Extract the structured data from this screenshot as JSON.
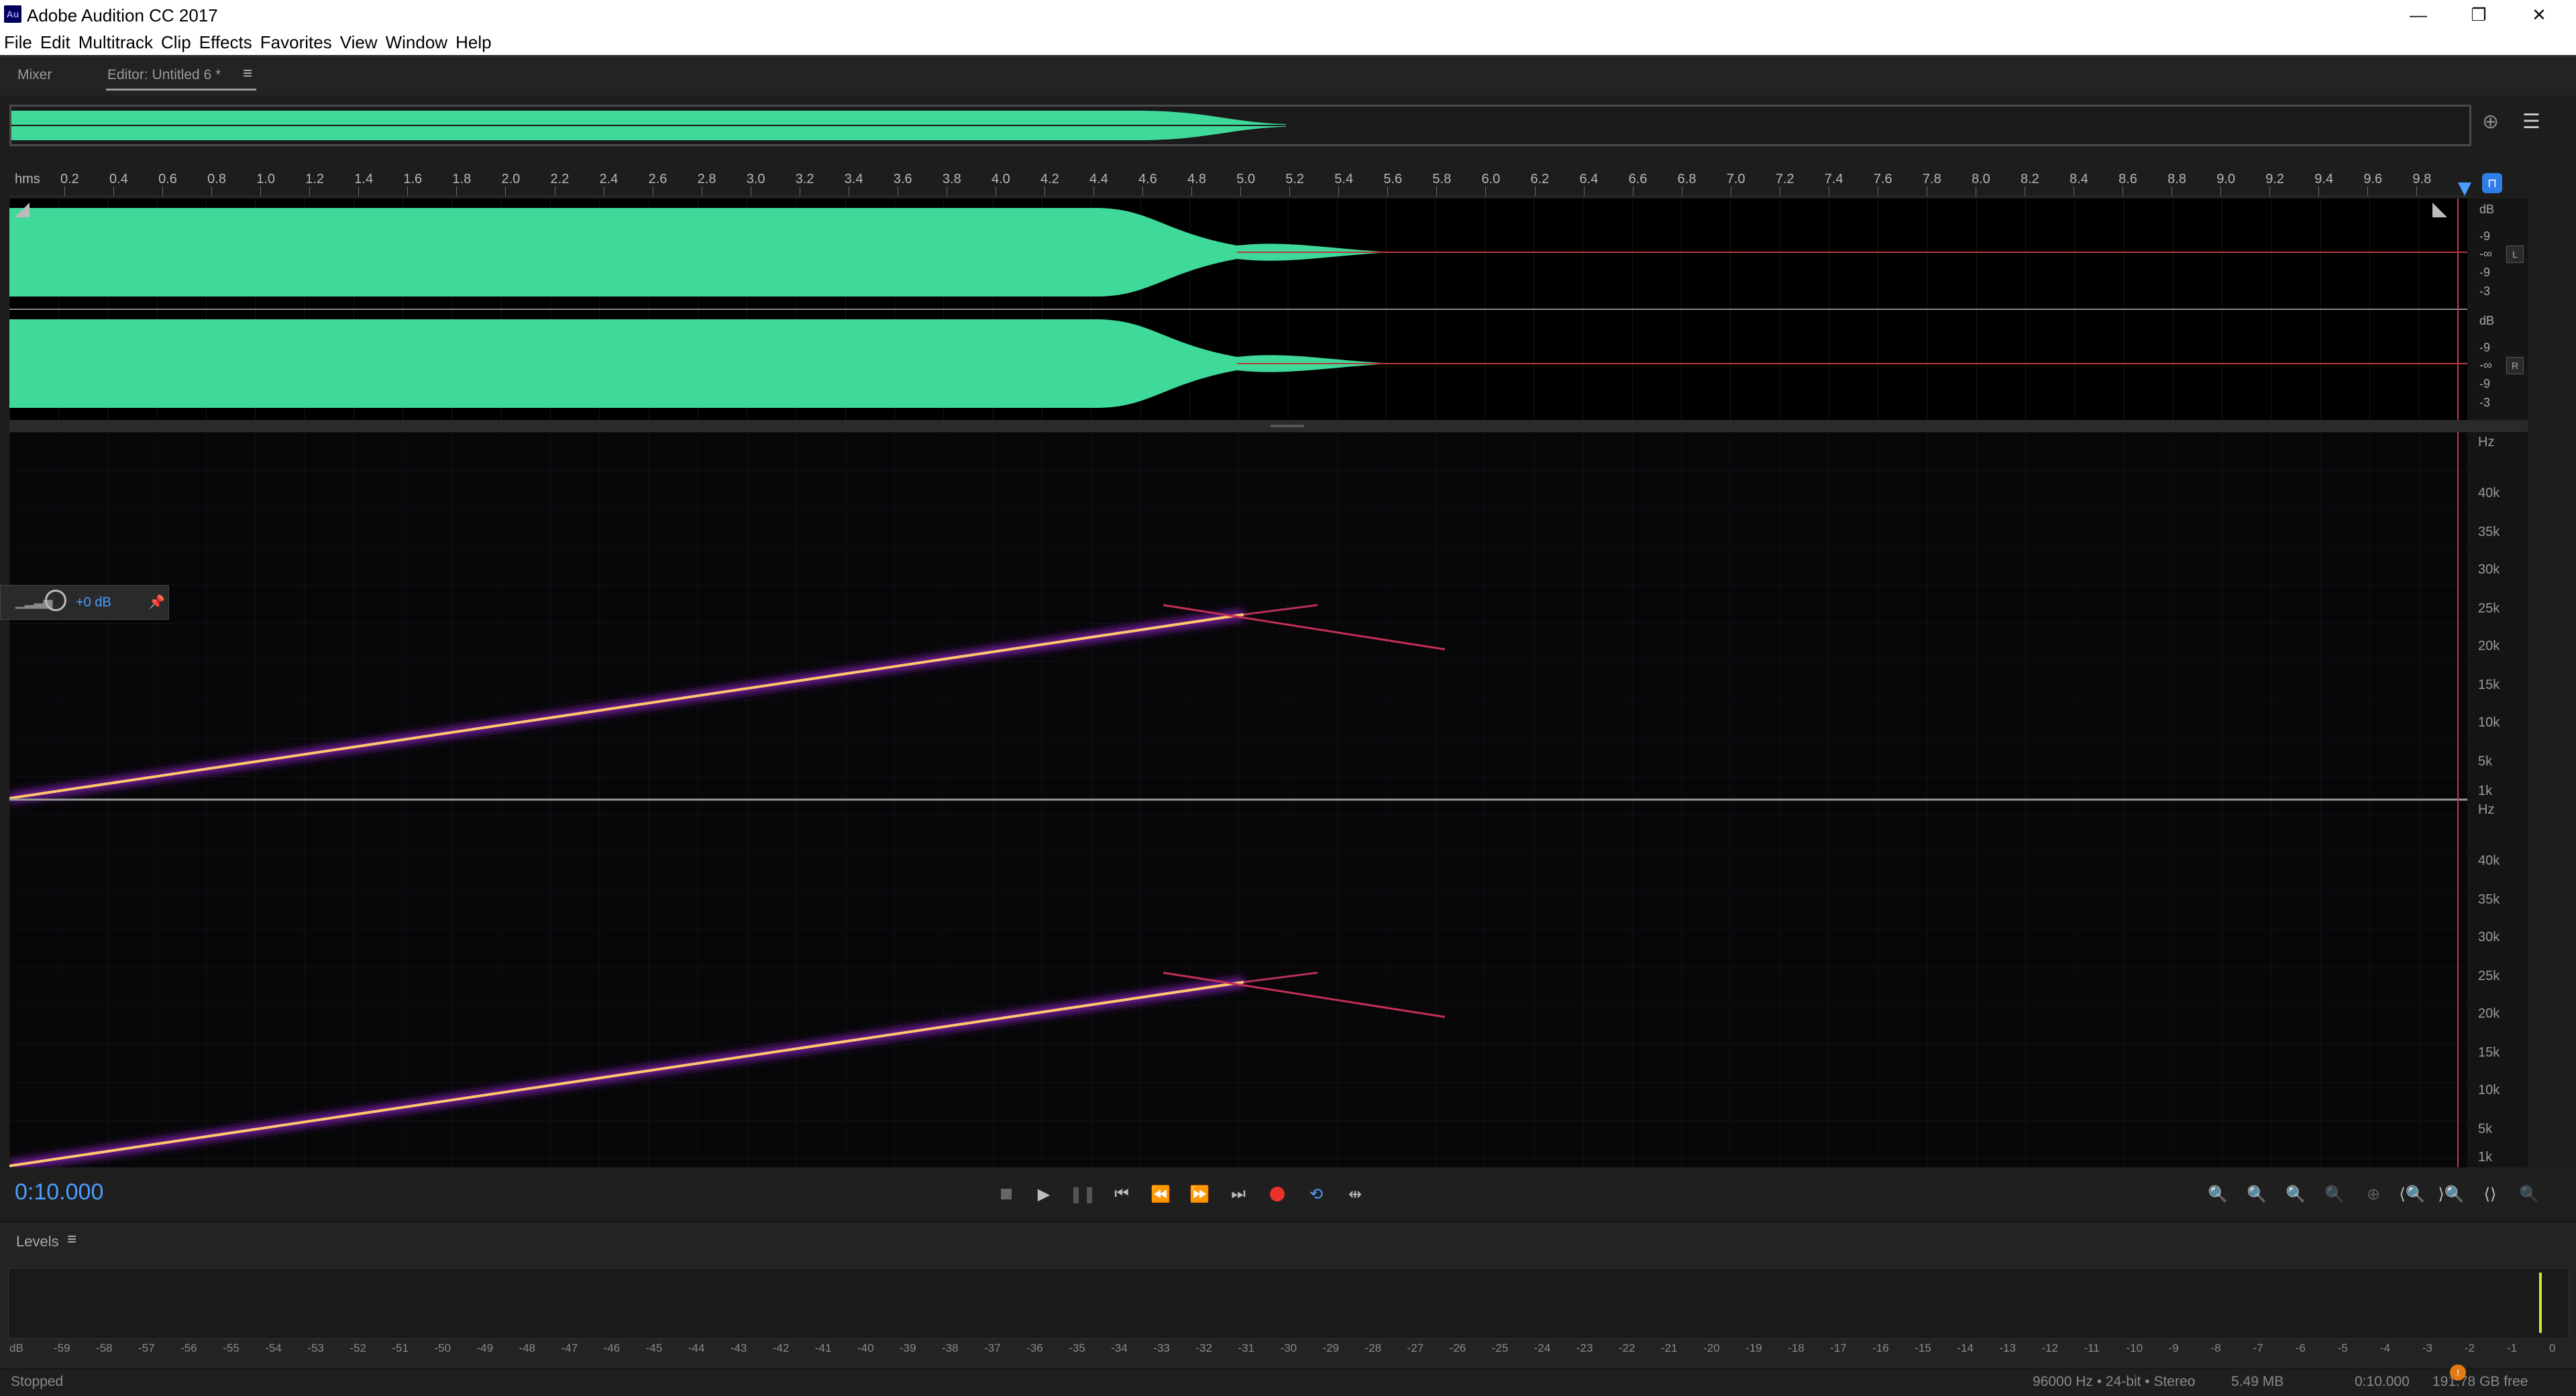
{
  "window": {
    "title": "Adobe Audition CC 2017",
    "app_icon_text": "Au"
  },
  "menu": [
    "File",
    "Edit",
    "Multitrack",
    "Clip",
    "Effects",
    "Favorites",
    "View",
    "Window",
    "Help"
  ],
  "panels": {
    "mixer_tab": "Mixer",
    "editor_tab": "Editor: Untitled 6 *"
  },
  "ruler": {
    "unit": "hms",
    "ticks": [
      "0.2",
      "0.4",
      "0.6",
      "0.8",
      "1.0",
      "1.2",
      "1.4",
      "1.6",
      "1.8",
      "2.0",
      "2.2",
      "2.4",
      "2.6",
      "2.8",
      "3.0",
      "3.2",
      "3.4",
      "3.6",
      "3.8",
      "4.0",
      "4.2",
      "4.4",
      "4.6",
      "4.8",
      "5.0",
      "5.2",
      "5.4",
      "5.6",
      "5.8",
      "6.0",
      "6.2",
      "6.4",
      "6.6",
      "6.8",
      "7.0",
      "7.2",
      "7.4",
      "7.6",
      "7.8",
      "8.0",
      "8.2",
      "8.4",
      "8.6",
      "8.8",
      "9.0",
      "9.2",
      "9.4",
      "9.6",
      "9.8"
    ]
  },
  "amplitude_scale": {
    "unit": "dB",
    "labels": [
      "-9",
      "-∞",
      "-9",
      "-3"
    ]
  },
  "channels": {
    "left": "L",
    "right": "R"
  },
  "spectral_scale": {
    "unit": "Hz",
    "labels": [
      "40k",
      "35k",
      "30k",
      "25k",
      "20k",
      "15k",
      "10k",
      "5k",
      "1k"
    ]
  },
  "hud": {
    "gain": "+0 dB"
  },
  "transport": {
    "timecode": "0:10.000"
  },
  "levels": {
    "title": "Levels",
    "scale_unit": "dB",
    "scale": [
      "-59",
      "-58",
      "-57",
      "-56",
      "-55",
      "-54",
      "-53",
      "-52",
      "-51",
      "-50",
      "-49",
      "-48",
      "-47",
      "-46",
      "-45",
      "-44",
      "-43",
      "-42",
      "-41",
      "-40",
      "-39",
      "-38",
      "-37",
      "-36",
      "-35",
      "-34",
      "-33",
      "-32",
      "-31",
      "-30",
      "-29",
      "-28",
      "-27",
      "-26",
      "-25",
      "-24",
      "-23",
      "-22",
      "-21",
      "-20",
      "-19",
      "-18",
      "-17",
      "-16",
      "-15",
      "-14",
      "-13",
      "-12",
      "-11",
      "-10",
      "-9",
      "-8",
      "-7",
      "-6",
      "-5",
      "-4",
      "-3",
      "-2",
      "-1",
      "0"
    ]
  },
  "status": {
    "state": "Stopped",
    "format": "96000 Hz • 24-bit • Stereo",
    "size": "5.49 MB",
    "duration": "0:10.000",
    "free": "191.78 GB free"
  },
  "colors": {
    "waveform": "#3fd99a",
    "timecode": "#4b9dff",
    "record": "#e8322a",
    "sweep": "#ffc76a"
  }
}
